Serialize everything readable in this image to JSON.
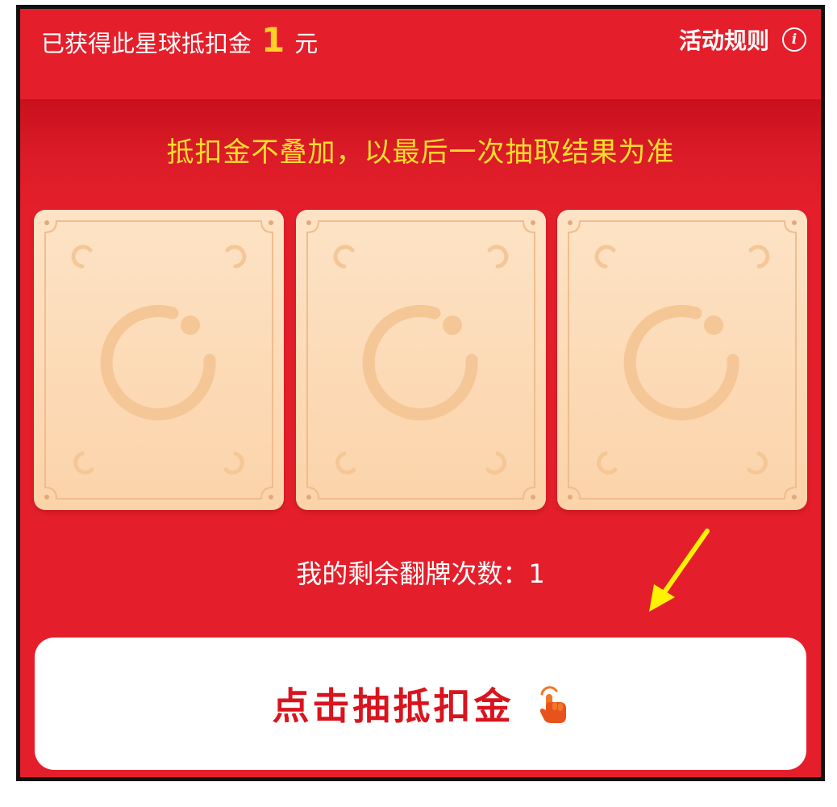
{
  "header": {
    "earned_prefix": "已获得此星球抵扣金",
    "earned_amount": "1",
    "earned_unit": "元",
    "rules_label": "活动规则",
    "info_icon_glyph": "i"
  },
  "notice": "抵扣金不叠加，以最后一次抽取结果为准",
  "cards": [
    {
      "icon": "ring-logo-icon",
      "state": "face-down"
    },
    {
      "icon": "ring-logo-icon",
      "state": "face-down"
    },
    {
      "icon": "ring-logo-icon",
      "state": "face-down"
    }
  ],
  "remaining_text": "我的剩余翻牌次数：1",
  "draw_button": {
    "label": "点击抽抵扣金",
    "icon": "hand-pointer-icon"
  },
  "colors": {
    "background_red": "#e41f2b",
    "notice_yellow": "#ffde2b",
    "card_peach": "#fbd3a9",
    "button_text_red": "#d9141e",
    "annotation_arrow_yellow": "#fff200"
  }
}
